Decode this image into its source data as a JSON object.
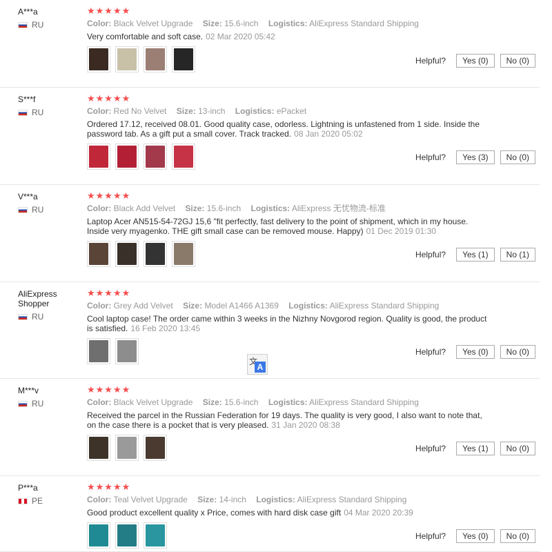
{
  "labels": {
    "color": "Color:",
    "size": "Size:",
    "logistics": "Logistics:",
    "helpful": "Helpful?"
  },
  "reviews": [
    {
      "user": "A***a",
      "country": "RU",
      "stars": "★★★★★",
      "color": "Black Velvet Upgrade",
      "size": "15.6-inch",
      "logistics": "AliExpress Standard Shipping",
      "text": "Very comfortable and soft case.",
      "date": "02 Mar 2020 05:42",
      "yes": "Yes (0)",
      "no": "No (0)",
      "photos": [
        "#3a2a22",
        "#c8c1a8",
        "#9b7e74",
        "#262626"
      ]
    },
    {
      "user": "S***f",
      "country": "RU",
      "stars": "★★★★★",
      "color": "Red No Velvet",
      "size": "13-inch",
      "logistics": "ePacket",
      "text": "Ordered 17.12, received 08.01. Good quality case, odorless. Lightning is unfastened from 1 side. Inside the password tab. As a gift put a small cover. Track tracked.",
      "date": "08 Jan 2020 05:02",
      "yes": "Yes (3)",
      "no": "No (0)",
      "photos": [
        "#c0283a",
        "#b32036",
        "#a23a4c",
        "#c63346"
      ]
    },
    {
      "user": "V***a",
      "country": "RU",
      "stars": "★★★★★",
      "color": "Black Add Velvet",
      "size": "15.6-inch",
      "logistics": "AliExpress 无忧物流-标准",
      "text": "Laptop Acer AN515-54-72GJ 15,6 \"fit perfectly, fast delivery to the point of shipment, which in my house. Inside very myagenko. THE gift small case can be removed mouse. Happy)",
      "date": "01 Dec 2019 01:30",
      "yes": "Yes (1)",
      "no": "No (1)",
      "photos": [
        "#5a4438",
        "#3a302a",
        "#333333",
        "#8a7a6a"
      ]
    },
    {
      "user": "AliExpress\nShopper",
      "country": "RU",
      "stars": "★★★★★",
      "color": "Grey Add Velvet",
      "size": "Model A1466 A1369",
      "logistics": "AliExpress Standard Shipping",
      "text": "Cool laptop case! The order came within 3 weeks in the Nizhny Novgorod region. Quality is good, the product is satisfied.",
      "date": "16 Feb 2020 13:45",
      "yes": "Yes (0)",
      "no": "No (0)",
      "photos": [
        "#6f6f6f",
        "#8d8d8d"
      ]
    },
    {
      "user": "M***v",
      "country": "RU",
      "stars": "★★★★★",
      "color": "Black Velvet Upgrade",
      "size": "15.6-inch",
      "logistics": "AliExpress Standard Shipping",
      "text": "Received the parcel in the Russian Federation for 19 days. The quality is very good, I also want to note that, on the case there is a pocket that is very pleased.",
      "date": "31 Jan 2020 08:38",
      "yes": "Yes (1)",
      "no": "No (0)",
      "photos": [
        "#3d3328",
        "#9a9a9a",
        "#4a3a30"
      ]
    },
    {
      "user": "P***a",
      "country": "PE",
      "stars": "★★★★★",
      "color": "Teal Velvet Upgrade",
      "size": "14-inch",
      "logistics": "AliExpress Standard Shipping",
      "text": "Good product excellent quality x Price, comes with hard disk case gift",
      "date": "04 Mar 2020 20:39",
      "yes": "Yes (0)",
      "no": "No (0)",
      "photos": [
        "#1f8a93",
        "#237d86",
        "#2a96a0"
      ]
    }
  ],
  "translate": {
    "zh": "文",
    "a": "A"
  }
}
